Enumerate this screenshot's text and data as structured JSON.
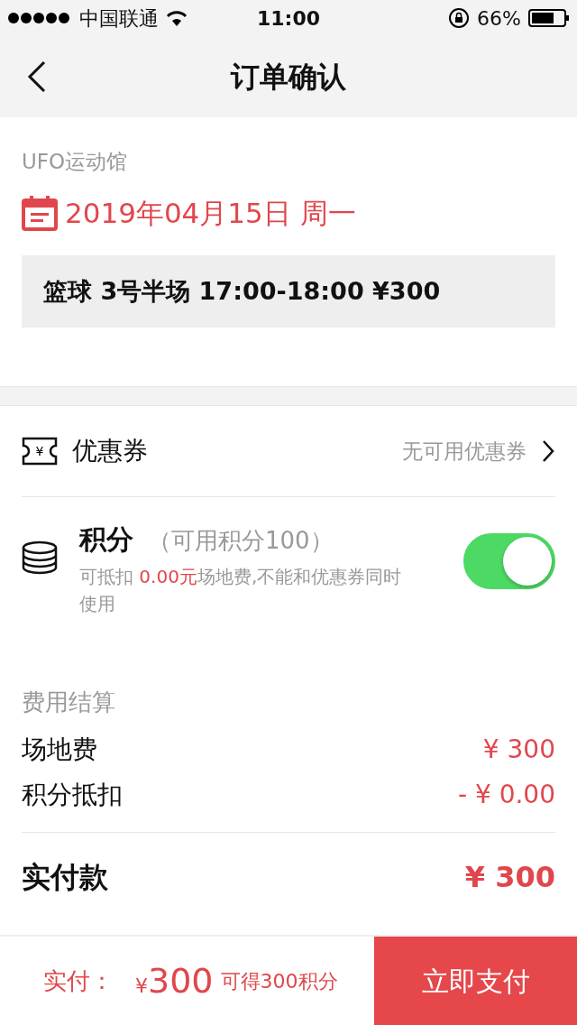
{
  "status_bar": {
    "carrier": "中国联通",
    "time": "11:00",
    "battery": "66%"
  },
  "nav": {
    "title": "订单确认"
  },
  "booking": {
    "venue": "UFO运动馆",
    "date": "2019年04月15日 周一",
    "slot": "篮球 3号半场 17:00-18:00 ¥300"
  },
  "coupon": {
    "icon_text": "¥",
    "label": "优惠券",
    "value": "无可用优惠券"
  },
  "points": {
    "label": "积分",
    "available": "（可用积分100）",
    "note_before": "可抵扣 ",
    "note_amount": "0.00元",
    "note_after": "场地费,不能和优惠券同时使用",
    "on": true
  },
  "fees": {
    "title": "费用结算",
    "items": [
      {
        "label": "场地费",
        "amount": "¥ 300"
      },
      {
        "label": "积分抵扣",
        "amount": "- ¥ 0.00"
      }
    ],
    "total_label": "实付款",
    "total": "¥ 300"
  },
  "footer": {
    "pay_label": "实付：",
    "currency": "¥",
    "amount": "300",
    "earn": "可得300积分",
    "button": "立即支付"
  }
}
